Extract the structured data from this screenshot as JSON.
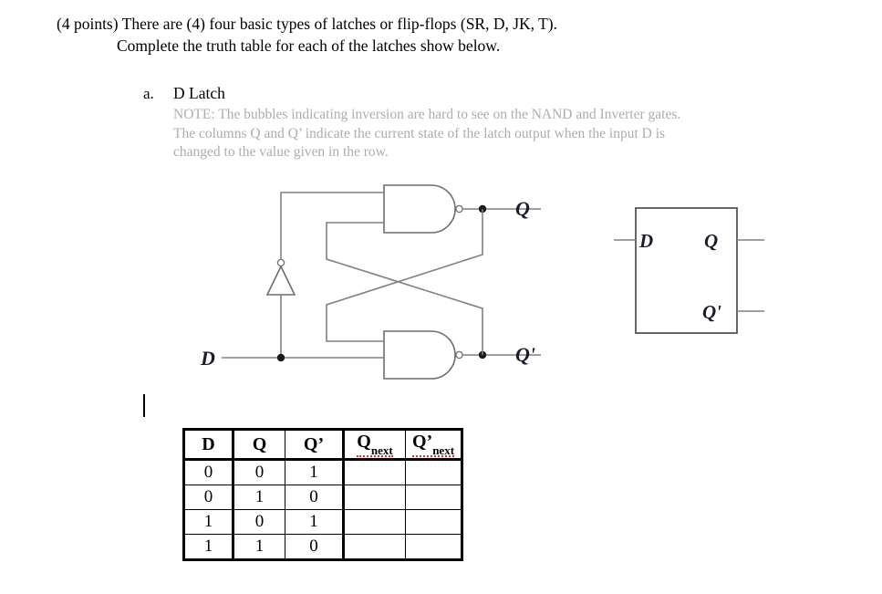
{
  "question": {
    "line1": "(4 points) There are (4) four basic types of latches or flip-flops (SR, D, JK, T).",
    "line2": "Complete the truth table for each of the latches show below."
  },
  "part_a": {
    "letter": "a.",
    "title": "D Latch",
    "note_lines": [
      "NOTE: The bubbles indicating inversion are hard to see on the NAND and Inverter gates.",
      "The columns Q and Q’ indicate the current state of the latch output when the input D is",
      "changed to the value given in the row."
    ]
  },
  "circuit": {
    "input_label": "D",
    "output_label_q": "Q",
    "output_label_qnot": "Q'",
    "gate_types": [
      "nand-gate",
      "nand-gate",
      "inverter-gate"
    ],
    "wire_color": "#808080",
    "gate_color": "#6d6d6d",
    "label_color": "#1b1b2e"
  },
  "block_symbol": {
    "input_label": "D",
    "output_label_q": "Q",
    "output_label_qnot": "Q'"
  },
  "truth_table": {
    "headers": [
      {
        "text": "D",
        "subscript": "",
        "misspelled": false
      },
      {
        "text": "Q",
        "subscript": "",
        "misspelled": false
      },
      {
        "text": "Q’",
        "subscript": "",
        "misspelled": false
      },
      {
        "text": "Q",
        "subscript": "next",
        "misspelled": true
      },
      {
        "text": "Q’",
        "subscript": "next",
        "misspelled": true
      }
    ],
    "rows": [
      [
        "0",
        "0",
        "1",
        "",
        ""
      ],
      [
        "0",
        "1",
        "0",
        "",
        ""
      ],
      [
        "1",
        "0",
        "1",
        "",
        ""
      ],
      [
        "1",
        "1",
        "0",
        "",
        ""
      ]
    ]
  },
  "caret": {
    "visible": "true"
  }
}
